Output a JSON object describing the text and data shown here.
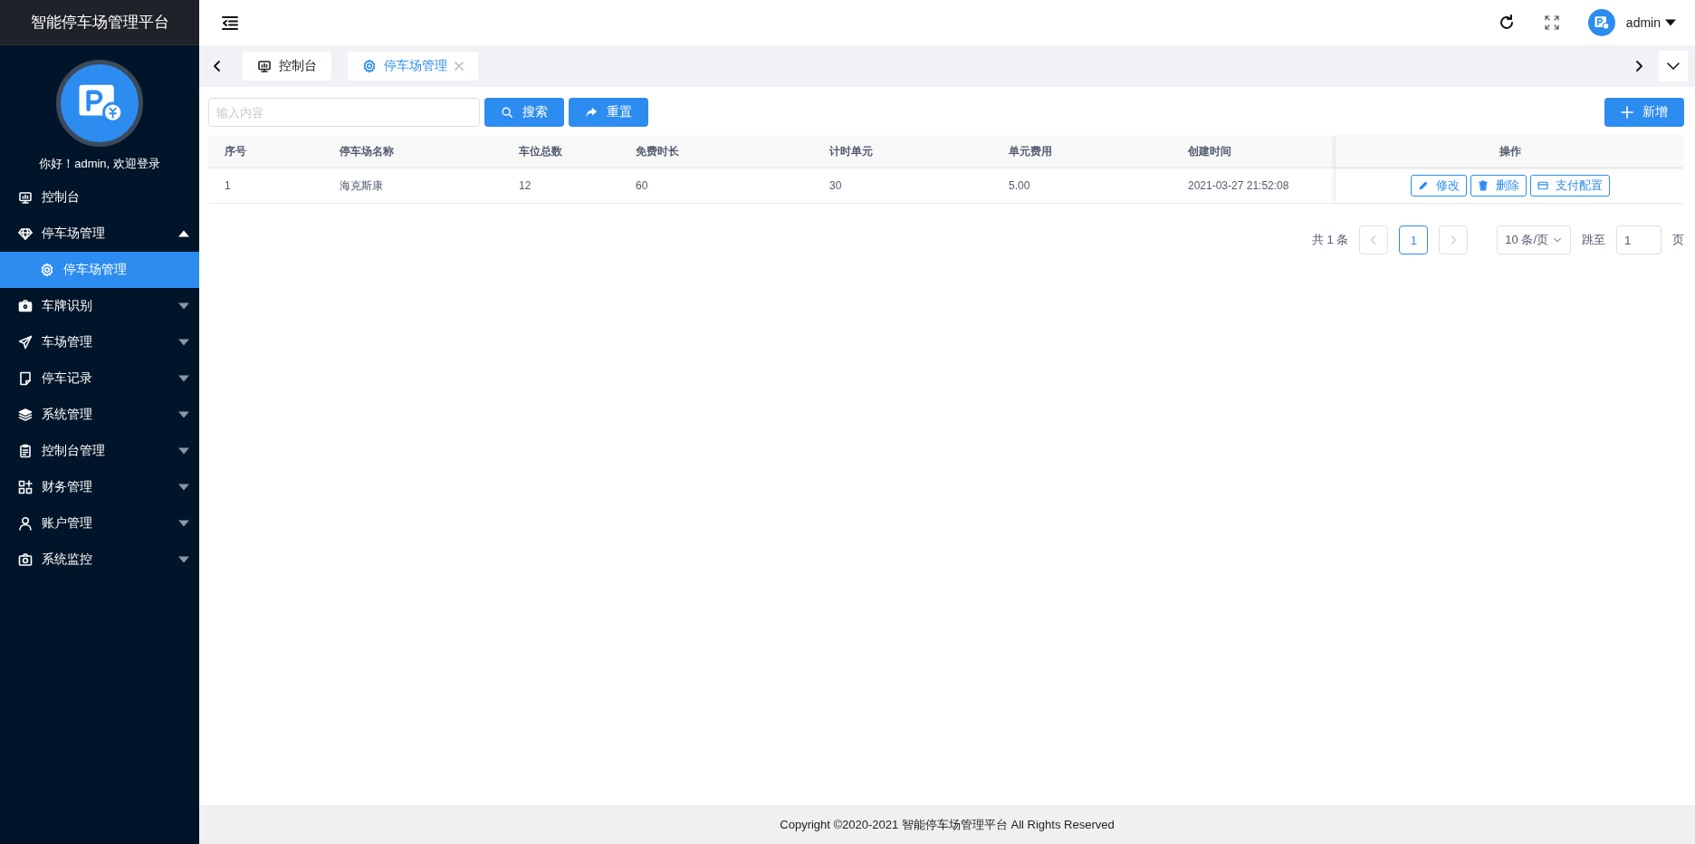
{
  "sidebar": {
    "title": "智能停车场管理平台",
    "greeting": "你好！admin, 欢迎登录",
    "items": [
      {
        "label": "控制台",
        "kind": "monitor",
        "selected": false
      },
      {
        "label": "停车场管理",
        "kind": "diamond",
        "expanded": true,
        "selected": false,
        "children": [
          {
            "label": "停车场管理",
            "kind": "gear",
            "selected": true
          }
        ]
      },
      {
        "label": "车牌识别",
        "kind": "camera-box",
        "expanded": false,
        "selected": false
      },
      {
        "label": "车场管理",
        "kind": "send",
        "expanded": false,
        "selected": false
      },
      {
        "label": "停车记录",
        "kind": "note",
        "expanded": false,
        "selected": false
      },
      {
        "label": "系统管理",
        "kind": "layers",
        "expanded": false,
        "selected": false
      },
      {
        "label": "控制台管理",
        "kind": "clipboard",
        "expanded": false,
        "selected": false
      },
      {
        "label": "财务管理",
        "kind": "apps",
        "expanded": false,
        "selected": false
      },
      {
        "label": "账户管理",
        "kind": "user",
        "expanded": false,
        "selected": false
      },
      {
        "label": "系统监控",
        "kind": "camera",
        "expanded": false,
        "selected": false
      }
    ]
  },
  "header": {
    "user": "admin"
  },
  "tabs": [
    {
      "label": "控制台",
      "kind": "monitor",
      "closable": false,
      "selected": false
    },
    {
      "label": "停车场管理",
      "kind": "gear",
      "closable": true,
      "selected": true
    }
  ],
  "toolbar": {
    "search": {
      "placeholder": "输入内容"
    },
    "buttons": [
      {
        "label": "搜索",
        "kind": "search"
      },
      {
        "label": "重置",
        "kind": "share"
      }
    ],
    "add_button": "新增"
  },
  "table": {
    "columns": [
      "序号",
      "停车场名称",
      "车位总数",
      "免费时长",
      "计时单元",
      "单元费用",
      "创建时间",
      "操作"
    ],
    "rows": [
      {
        "cells": [
          "1",
          "海克斯康",
          "12",
          "60",
          "30",
          "5.00",
          "2021-03-27 21:52:08"
        ],
        "actions": [
          {
            "label": "修改",
            "kind": "pencil"
          },
          {
            "label": "删除",
            "kind": "trash"
          },
          {
            "label": "支付配置",
            "kind": "card"
          }
        ]
      }
    ]
  },
  "pagination": {
    "total": "共 1 条",
    "pages": [
      {
        "label": "1",
        "selected": true
      }
    ],
    "page_size": "10 条/页",
    "jump_label": "跳至",
    "jump_value": "1",
    "page_suffix": "页"
  },
  "footer": "Copyright ©2020-2021 智能停车场管理平台 All Rights Reserved"
}
